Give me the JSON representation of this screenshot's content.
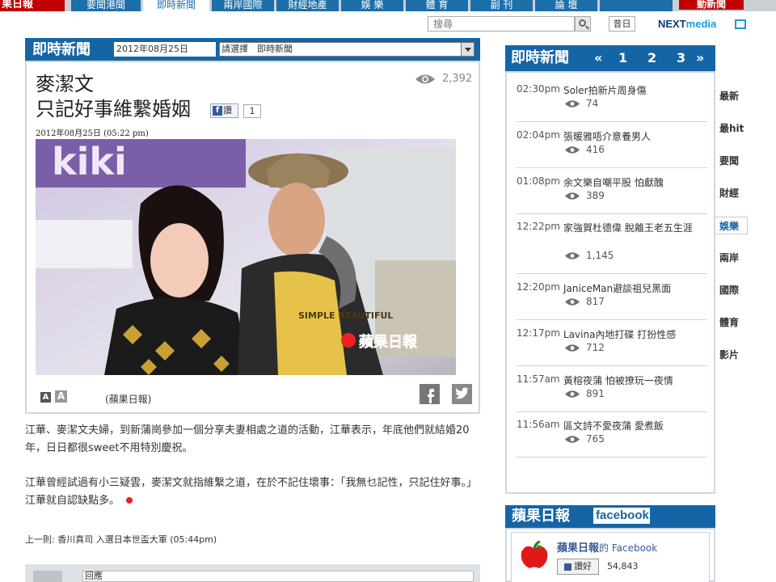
{
  "top_nav": {
    "logo_text": "果日報",
    "tabs": [
      {
        "label": "要聞港聞"
      },
      {
        "label": "即時新聞"
      },
      {
        "label": "兩岸國際"
      },
      {
        "label": "財經地產"
      },
      {
        "label": "娛 樂"
      },
      {
        "label": "體 育"
      },
      {
        "label": "副 刊"
      },
      {
        "label": "論 壇"
      }
    ],
    "right_logo_text": "動新聞"
  },
  "search": {
    "placeholder": "搜尋",
    "old_issues_label": "昔日"
  },
  "nextmedia": {
    "prefix": "NEXT",
    "suffix": "media"
  },
  "section": {
    "title": "即時新聞",
    "date": "2012年08月25日",
    "select_value": "請選擇　即時新聞"
  },
  "article": {
    "headline_line1": "麥潔文",
    "headline_line2": "只記好事維繫婚姻",
    "share_label": "讚",
    "share_count": "1",
    "view_count": "2,392",
    "date": "2012年08月25日 (05:22 pm)",
    "photo_caption": "蘋果日報",
    "photo_sign_text": "kiki",
    "photo_shirt_text": "SIMPLE BEAUTIFUL",
    "font_small": "A",
    "font_large": "A",
    "credit": "(蘋果日報)",
    "paragraphs": [
      "江華、麥潔文夫婦，到新蒲崗參加一個分享夫妻相處之道的活動，江華表示，年底他們就結婚20年，日日都很sweet不用特別慶祝。",
      "江華曾經試過有小三疑雲，麥潔文就指維繫之道，在於不記住壞事：「我無乜記性，只記住好事。」江華就自認缺點多。"
    ],
    "prev_link": "上一則: 香川真司 入選日本世盃大軍 (05:44pm)"
  },
  "comment": {
    "placeholder": "回應"
  },
  "sidebar_news": {
    "title": "即時新聞",
    "pages": [
      "1",
      "2",
      "3"
    ],
    "items": [
      {
        "time": "02:30pm",
        "title": "Soler拍新片周身傷",
        "views": "74"
      },
      {
        "time": "02:04pm",
        "title": "張暖雅唔介意養男人",
        "views": "416"
      },
      {
        "time": "01:08pm",
        "title": "余文樂自嘲平股 怕獻醜",
        "views": "389"
      },
      {
        "time": "12:22pm",
        "title": "家強賀杜德偉 脫離王老五生涯",
        "views": "1,145"
      },
      {
        "time": "12:20pm",
        "title": "JaniceMan避談祖兒黑面",
        "views": "817"
      },
      {
        "time": "12:17pm",
        "title": "Lavina內地打碟 打扮性感",
        "views": "712"
      },
      {
        "time": "11:57am",
        "title": "黃榕夜蒲 怕被撩玩一夜情",
        "views": "891"
      },
      {
        "time": "11:56am",
        "title": "區文詩不愛夜蒲 愛煮飯",
        "views": "765"
      }
    ]
  },
  "categories": [
    {
      "label": "最新"
    },
    {
      "label": "最hit"
    },
    {
      "label": "要聞"
    },
    {
      "label": "財經"
    },
    {
      "label": "娛樂"
    },
    {
      "label": "兩岸"
    },
    {
      "label": "國際"
    },
    {
      "label": "體育"
    },
    {
      "label": "影片"
    }
  ],
  "facebook_panel": {
    "title": "蘋果日報",
    "logo": "facebook",
    "page_name": "蘋果日報",
    "page_suffix": "的 Facebook",
    "like_label": "讚好",
    "likes": "54,843"
  },
  "colors": {
    "brand_blue": "#1565a6",
    "brand_red": "#c00000"
  }
}
